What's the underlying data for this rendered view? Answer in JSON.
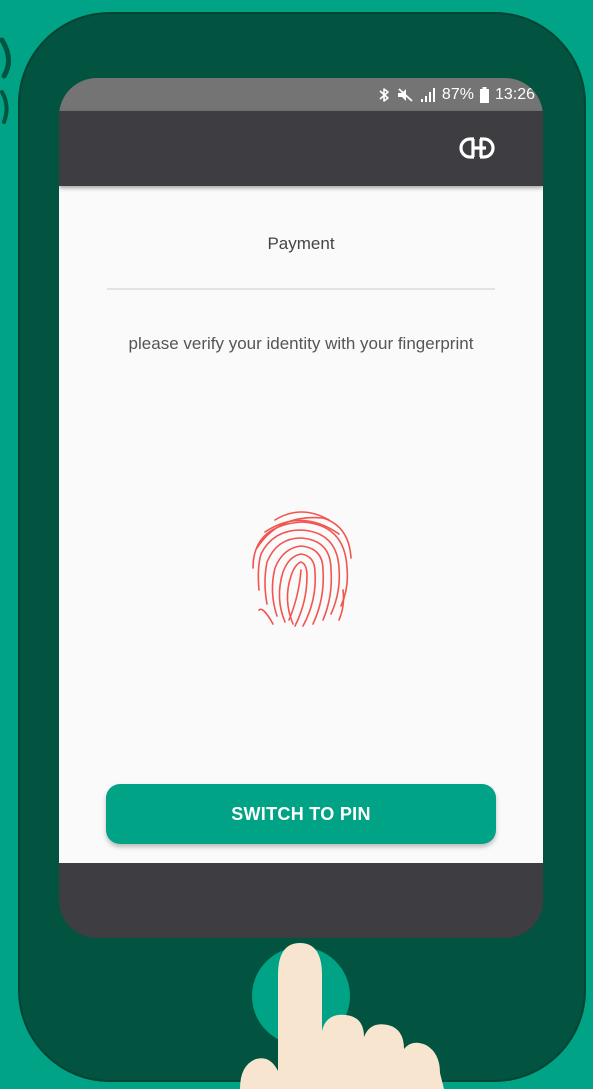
{
  "status_bar": {
    "battery": "87%",
    "time": "13:26",
    "icons": [
      "bluetooth-icon",
      "mute-icon",
      "signal-icon",
      "battery-icon"
    ]
  },
  "app_bar": {
    "icon": "link-icon"
  },
  "payment": {
    "title": "Payment",
    "instruction": "please verify your identity with your fingerprint",
    "fingerprint_icon": "fingerprint-icon",
    "switch_button_label": "SWITCH TO PIN"
  },
  "colors": {
    "background": "#00a386",
    "phone_body": "#02533f",
    "bars": "#3e3e42",
    "status_bar": "#747474",
    "accent": "#00a386",
    "fingerprint": "#f2554f"
  }
}
